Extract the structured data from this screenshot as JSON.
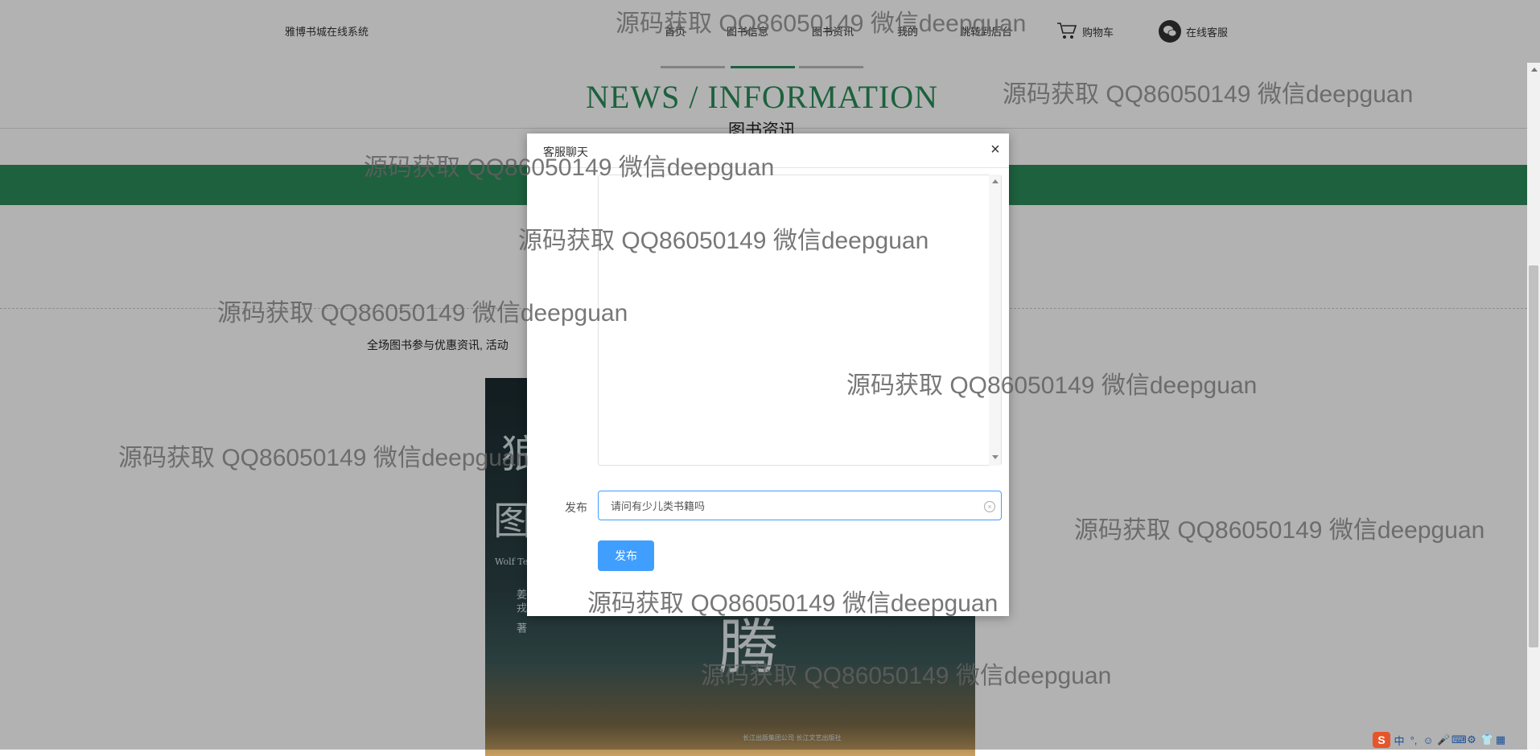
{
  "header": {
    "brand": "雅博书城在线系统",
    "nav": [
      "首页",
      "图书信息",
      "图书资讯",
      "我的",
      "跳转到后台"
    ],
    "cart_label": "购物车",
    "chat_label": "在线客服",
    "cart_icon": "cart-icon",
    "chat_icon": "wechat-icon"
  },
  "section": {
    "title": "NEWS / INFORMATION",
    "subtitle": "图书资讯"
  },
  "promo_text": "全场图书参与优惠资讯, 活动",
  "book_cover": {
    "title_chars": [
      "狼",
      "图",
      "腾"
    ],
    "subtitle": "Wolf Te",
    "author": "姜戎 著",
    "publisher": "长江出版集团公司 长江文艺出版社"
  },
  "dialog": {
    "title": "客服聊天",
    "close_symbol": "×",
    "post_label": "发布",
    "input_value": "请问有少儿类书籍吗",
    "button_label": "发布"
  },
  "watermark": "源码获取 QQ86050149 微信deepguan",
  "taskbar": {
    "logo": "S",
    "items": [
      "中",
      "°,",
      "☺",
      "🎤",
      "⌨",
      "⚙",
      "👕",
      "▦"
    ]
  },
  "colors": {
    "accent_green": "#2a8c5a",
    "button_blue": "#409eff"
  }
}
